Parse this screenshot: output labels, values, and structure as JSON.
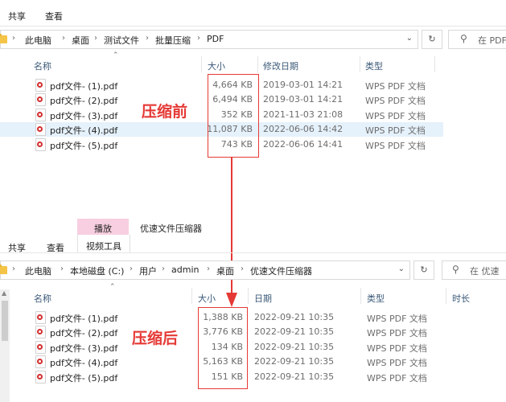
{
  "top": {
    "menu": [
      "共享",
      "查看"
    ],
    "breadcrumb": [
      "此电脑",
      "桌面",
      "测试文件",
      "批量压缩",
      "PDF"
    ],
    "search_placeholder": "在 PDF",
    "columns": [
      "名称",
      "大小",
      "修改日期",
      "类型"
    ],
    "files": [
      {
        "name": "pdf文件- (1).pdf",
        "size": "4,664 KB",
        "date": "2019-03-01 14:21",
        "type": "WPS PDF 文档"
      },
      {
        "name": "pdf文件- (2).pdf",
        "size": "6,494 KB",
        "date": "2019-03-01 14:21",
        "type": "WPS PDF 文档"
      },
      {
        "name": "pdf文件- (3).pdf",
        "size": "352 KB",
        "date": "2021-11-03 21:08",
        "type": "WPS PDF 文档"
      },
      {
        "name": "pdf文件- (4).pdf",
        "size": "11,087 KB",
        "date": "2022-06-06 14:42",
        "type": "WPS PDF 文档"
      },
      {
        "name": "pdf文件- (5).pdf",
        "size": "743 KB",
        "date": "2022-06-06 14:41",
        "type": "WPS PDF 文档"
      }
    ],
    "annotation": "压缩前"
  },
  "bottom": {
    "ribbon_context_tab": "播放",
    "ribbon_window_title": "优速文件压缩器",
    "menu": [
      "共享",
      "查看"
    ],
    "ribbon_tool": "视频工具",
    "breadcrumb": [
      "此电脑",
      "本地磁盘 (C:)",
      "用户",
      "admin",
      "桌面",
      "优速文件压缩器"
    ],
    "search_placeholder": "在 优速",
    "columns": [
      "名称",
      "大小",
      "日期",
      "类型",
      "时长"
    ],
    "files": [
      {
        "name": "pdf文件- (1).pdf",
        "size": "1,388 KB",
        "date": "2022-09-21 10:35",
        "type": "WPS PDF 文档"
      },
      {
        "name": "pdf文件- (2).pdf",
        "size": "3,776 KB",
        "date": "2022-09-21 10:35",
        "type": "WPS PDF 文档"
      },
      {
        "name": "pdf文件- (3).pdf",
        "size": "134 KB",
        "date": "2022-09-21 10:35",
        "type": "WPS PDF 文档"
      },
      {
        "name": "pdf文件- (4).pdf",
        "size": "5,163 KB",
        "date": "2022-09-21 10:35",
        "type": "WPS PDF 文档"
      },
      {
        "name": "pdf文件- (5).pdf",
        "size": "151 KB",
        "date": "2022-09-21 10:35",
        "type": "WPS PDF 文档"
      }
    ],
    "annotation": "压缩后"
  },
  "colors": {
    "accent_red": "#e53935",
    "selected_row": "#e5f1fb",
    "ribbon_pink": "#f7cfe0"
  },
  "icons": [
    "folder-icon",
    "chevron-down-icon",
    "refresh-icon",
    "search-icon",
    "pdf-file-icon",
    "sort-up-icon"
  ]
}
